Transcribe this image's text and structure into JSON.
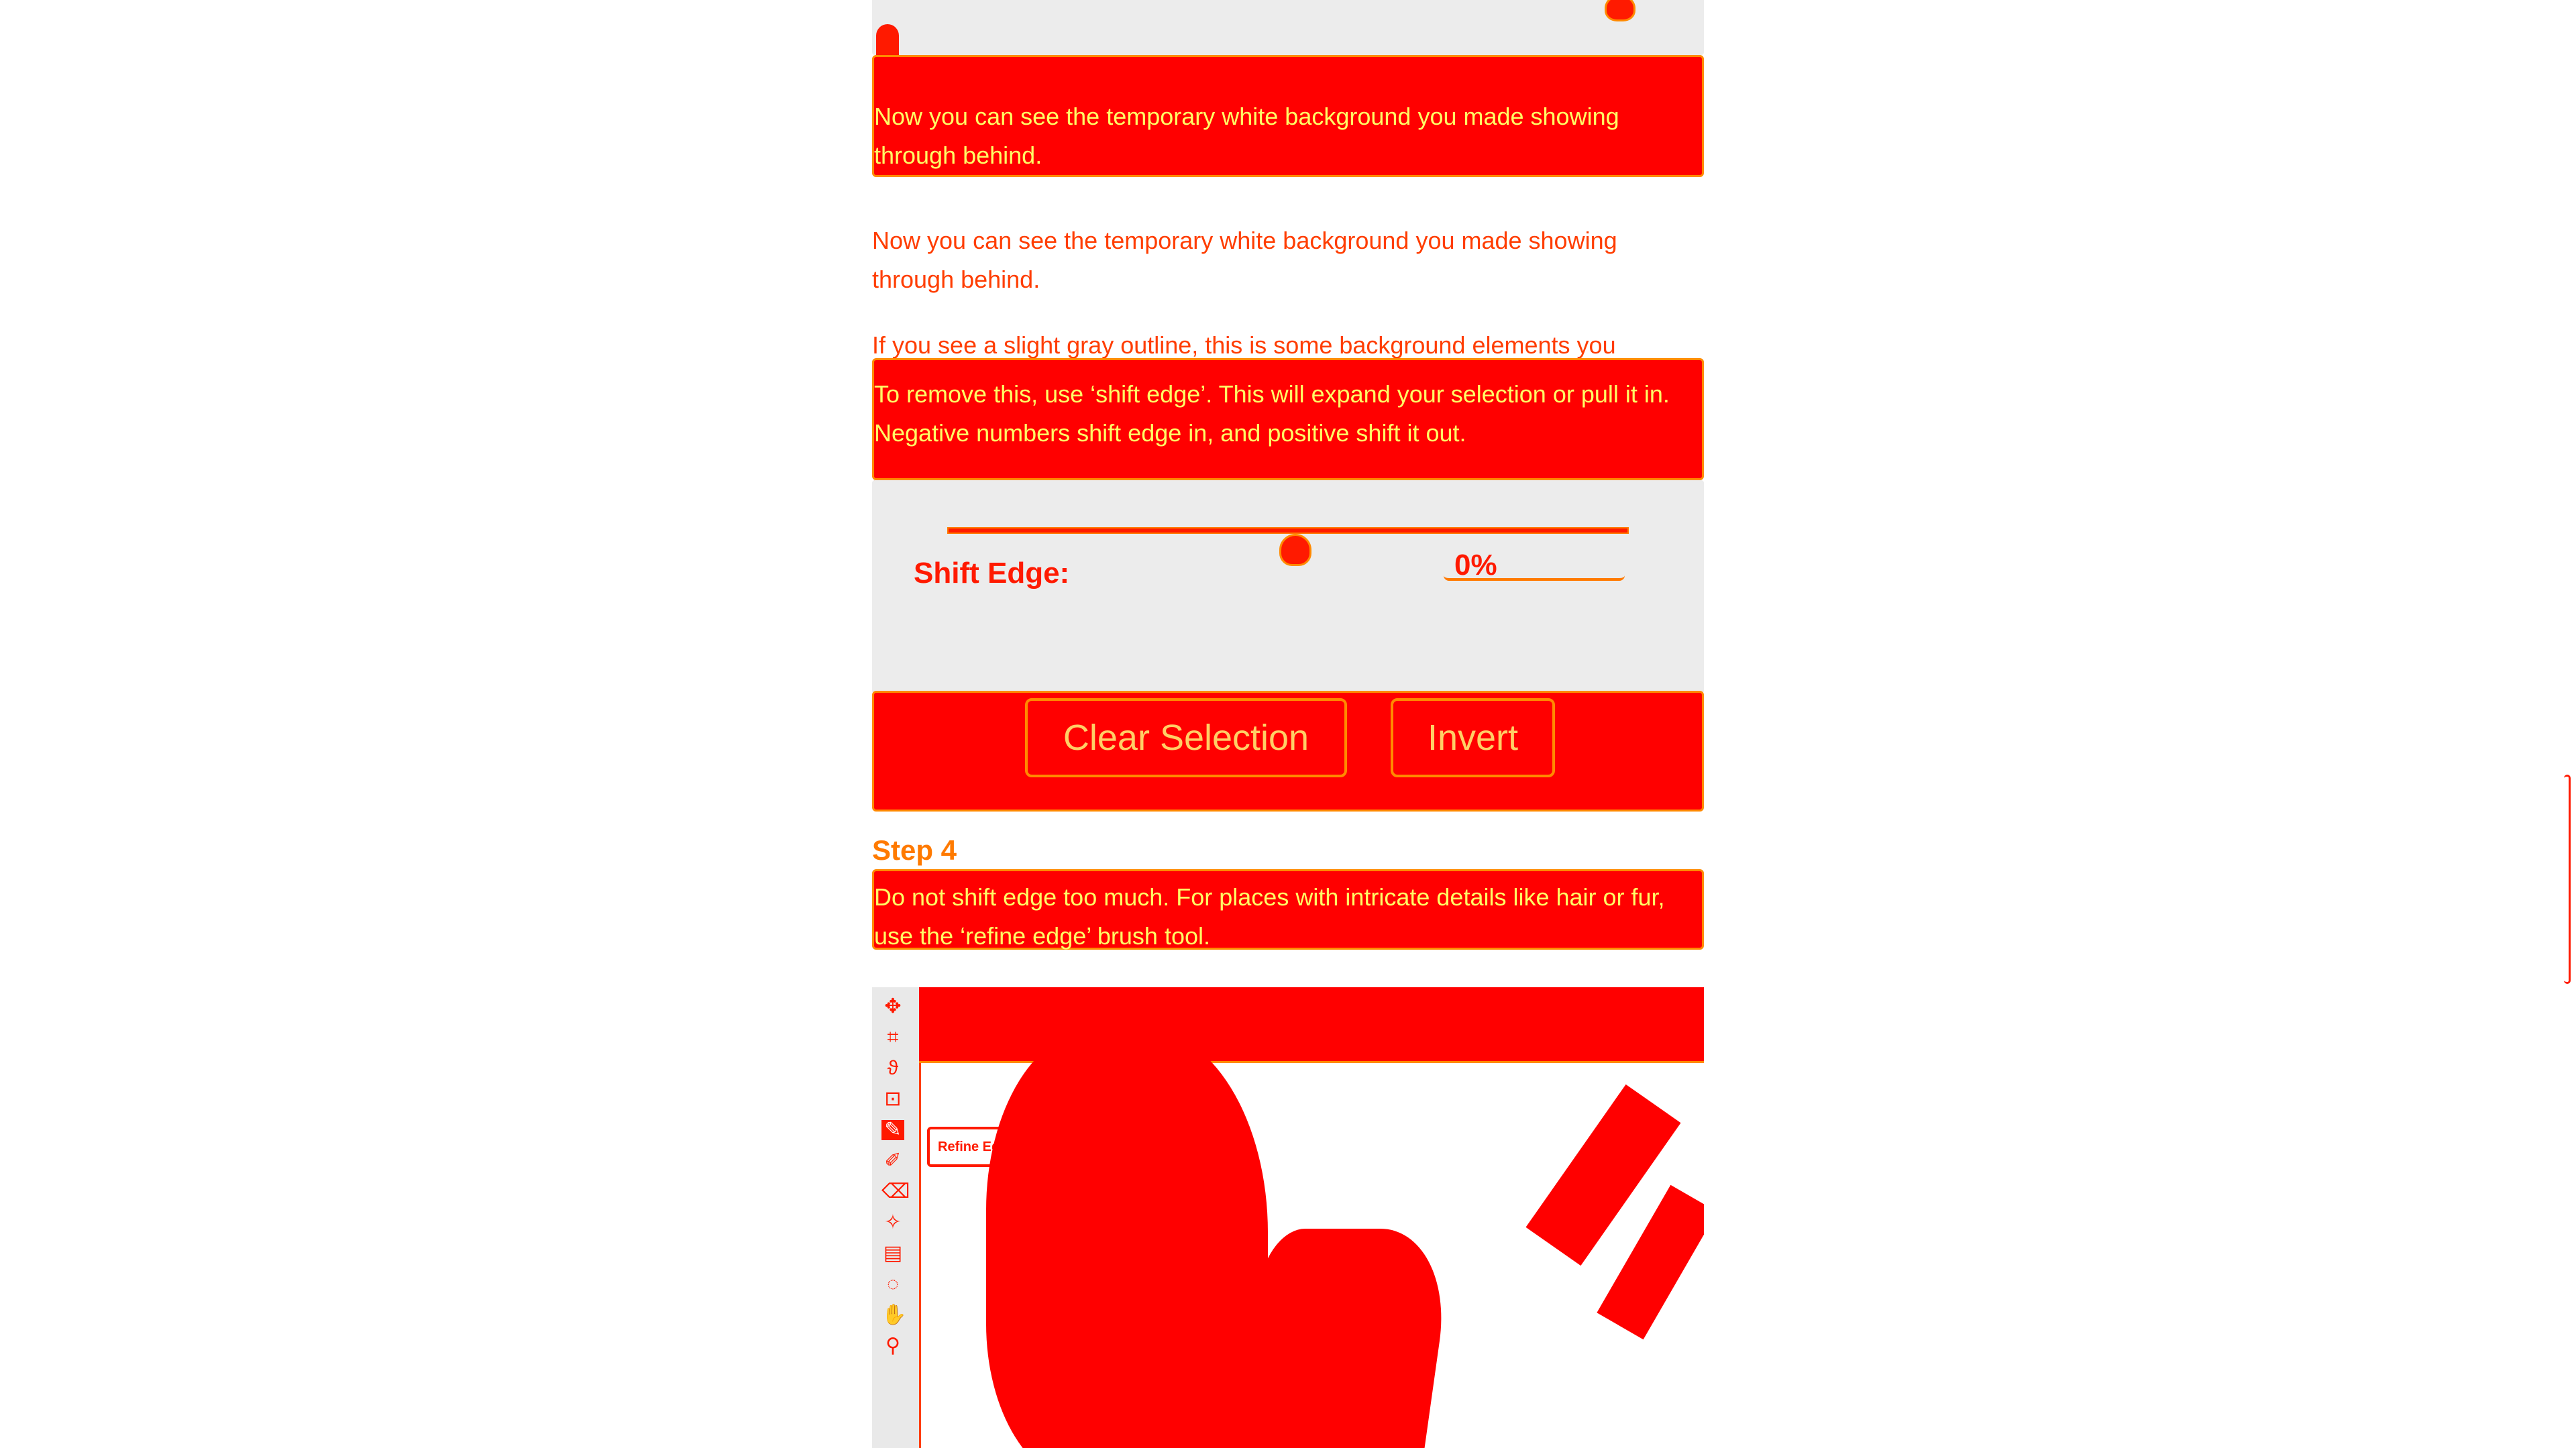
{
  "article": {
    "para_background": "Now you can see the temporary white background you made showing through behind.",
    "para_outline": "If you see a slight gray outline, this is some background elements you picked up when using the quick selection tool.",
    "para_shift": "To remove this, use ‘shift edge’. This will expand your selection or pull it in. Negative numbers shift edge in, and positive shift it out.",
    "shift_edge_label": "Shift Edge:",
    "shift_edge_value": "0%",
    "shift_edge_fraction": 0.5,
    "clear_selection_label": "Clear Selection",
    "invert_label": "Invert",
    "step_title": "Step 4",
    "para_refine": "Do not shift edge too much. For places with intricate details like hair or fur, use the ‘refine edge’ brush tool.",
    "tooltip_label": "Refine Edge Brush Tool (R)"
  },
  "colors": {
    "highlight": "#ff0000",
    "outline": "#ff8a00",
    "text_on_red": "#ffff66",
    "panel_gray": "#ececec"
  },
  "toolbar_icons": [
    "move-icon",
    "artboard-icon",
    "lasso-icon",
    "quick-select-icon",
    "refine-edge-brush-icon",
    "brush-icon",
    "eraser-icon",
    "magic-wand-icon",
    "note-icon",
    "speech-icon",
    "hand-icon",
    "zoom-icon"
  ]
}
